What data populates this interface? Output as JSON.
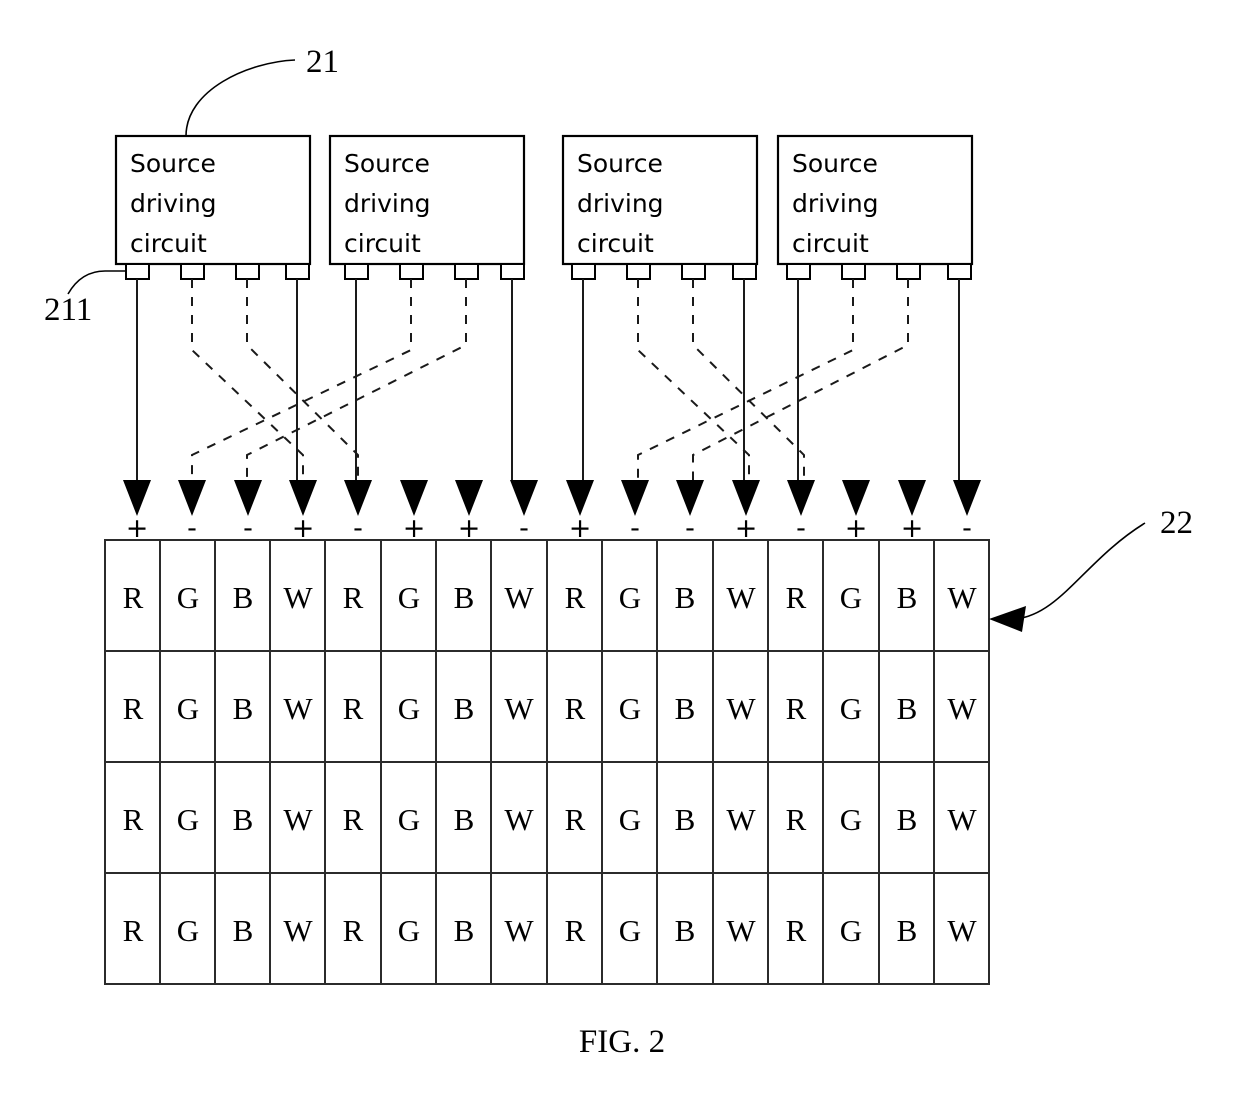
{
  "figure": {
    "caption": "FIG. 2",
    "reference_labels": [
      {
        "id": "21",
        "text": "21",
        "points_to": "source-driving-circuit-block"
      },
      {
        "id": "211",
        "text": "211",
        "points_to": "output-pad"
      },
      {
        "id": "22",
        "text": "22",
        "points_to": "pixel-array"
      }
    ]
  },
  "driver_blocks": [
    {
      "index": 1,
      "line1": "Source",
      "line2": "driving",
      "line3": "circuit",
      "pads": 4
    },
    {
      "index": 2,
      "line1": "Source",
      "line2": "driving",
      "line3": "circuit",
      "pads": 4
    },
    {
      "index": 3,
      "line1": "Source",
      "line2": "driving",
      "line3": "circuit",
      "pads": 4
    },
    {
      "index": 4,
      "line1": "Source",
      "line2": "driving",
      "line3": "circuit",
      "pads": 4
    }
  ],
  "polarities": [
    "+",
    "-",
    "-",
    "+",
    "-",
    "+",
    "+",
    "-",
    "+",
    "-",
    "-",
    "+",
    "-",
    "+",
    "+",
    "-"
  ],
  "pixel_array": {
    "columns": 16,
    "rows": 4,
    "column_labels": [
      "R",
      "G",
      "B",
      "W",
      "R",
      "G",
      "B",
      "W",
      "R",
      "G",
      "B",
      "W",
      "R",
      "G",
      "B",
      "W"
    ],
    "grid": [
      [
        "R",
        "G",
        "B",
        "W",
        "R",
        "G",
        "B",
        "W",
        "R",
        "G",
        "B",
        "W",
        "R",
        "G",
        "B",
        "W"
      ],
      [
        "R",
        "G",
        "B",
        "W",
        "R",
        "G",
        "B",
        "W",
        "R",
        "G",
        "B",
        "W",
        "R",
        "G",
        "B",
        "W"
      ],
      [
        "R",
        "G",
        "B",
        "W",
        "R",
        "G",
        "B",
        "W",
        "R",
        "G",
        "B",
        "W",
        "R",
        "G",
        "B",
        "W"
      ],
      [
        "R",
        "G",
        "B",
        "W",
        "R",
        "G",
        "B",
        "W",
        "R",
        "G",
        "B",
        "W",
        "R",
        "G",
        "B",
        "W"
      ]
    ]
  },
  "wiring": {
    "solid_routes": [
      1,
      4,
      5,
      8,
      9,
      12,
      13,
      16
    ],
    "dashed_routes": [
      2,
      3,
      6,
      7,
      10,
      11,
      14,
      15
    ],
    "description": "crossed-data-line-routing"
  },
  "colors": {
    "ink": "#000000",
    "line": "#1a1a1a",
    "grid": "#2b2b2b",
    "background": "#ffffff"
  }
}
